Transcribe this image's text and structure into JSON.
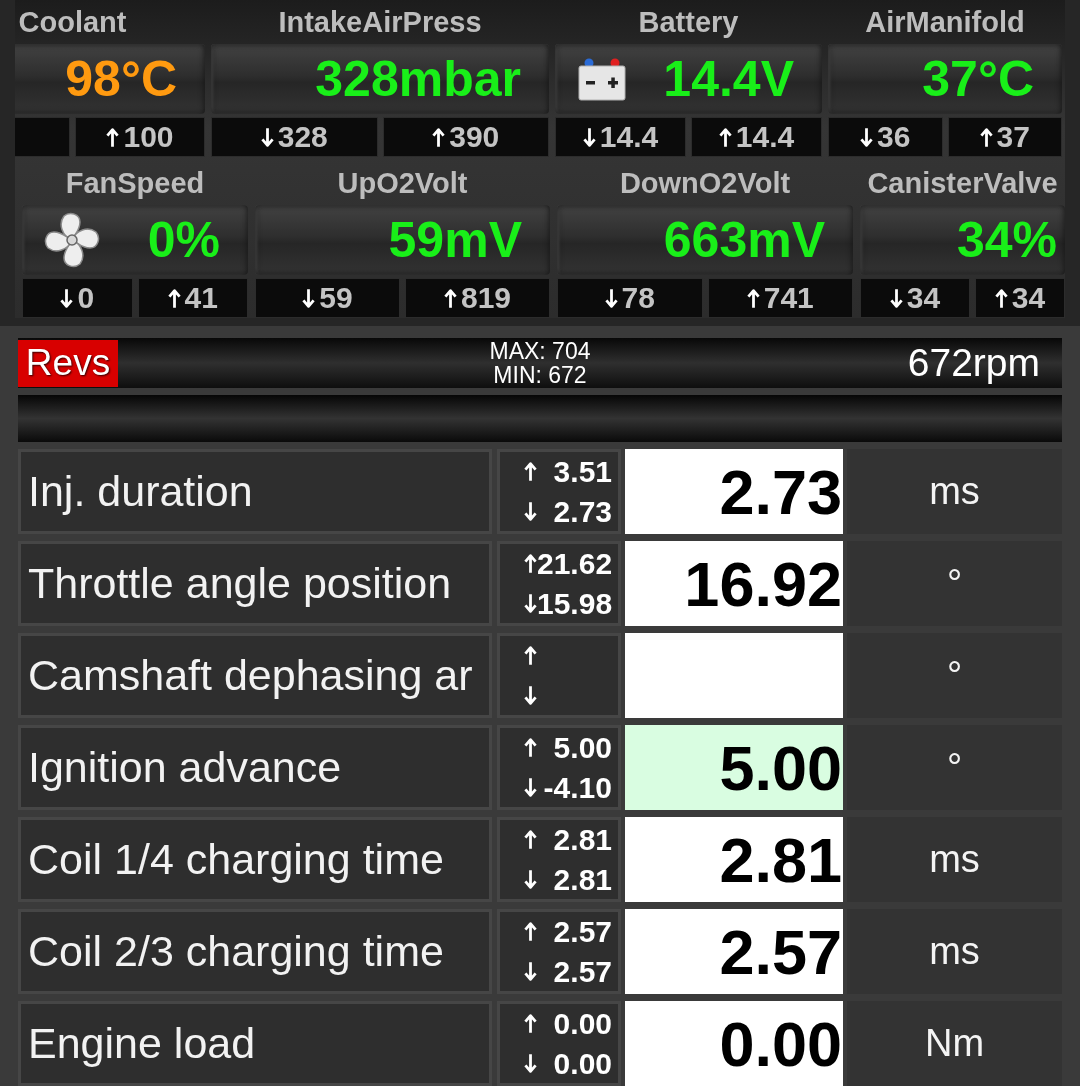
{
  "gauge_rows": [
    {
      "gauges": [
        {
          "label": "Coolant",
          "kind": "plain",
          "value": "98°C",
          "alert": true,
          "max": "100"
        },
        {
          "label": "IntakeAirPress",
          "kind": "plain",
          "value": "328mbar",
          "alert": false,
          "min": "328",
          "max": "390"
        },
        {
          "label": "Battery",
          "kind": "battery",
          "value": "14.4V",
          "alert": false,
          "min": "14.4",
          "max": "14.4"
        },
        {
          "label": "AirManifold",
          "kind": "plain",
          "value": "37°C",
          "alert": false,
          "min": "36",
          "max": "37"
        }
      ]
    },
    {
      "gauges": [
        {
          "label": "FanSpeed",
          "kind": "fan",
          "value": "0%",
          "alert": false,
          "min": "0",
          "max": "41"
        },
        {
          "label": "UpO2Volt",
          "kind": "plain",
          "value": "59mV",
          "alert": false,
          "min": "59",
          "max": "819"
        },
        {
          "label": "DownO2Volt",
          "kind": "plain",
          "value": "663mV",
          "alert": false,
          "min": "78",
          "max": "741"
        },
        {
          "label": "CanisterValve",
          "kind": "plain",
          "value": "34%",
          "alert": false,
          "min": "34",
          "max": "34"
        }
      ]
    }
  ],
  "revs": {
    "label": "Revs",
    "max": "MAX: 704",
    "min": "MIN: 672",
    "value": "672rpm"
  },
  "table": {
    "rows": [
      {
        "name": "Inj. duration",
        "max": "3.51",
        "min": "2.73",
        "value": "2.73",
        "unit": "ms",
        "highlighted": false
      },
      {
        "name": "Throttle angle position",
        "max": "21.62",
        "min": "15.98",
        "value": "16.92",
        "unit": "°",
        "highlighted": false
      },
      {
        "name": "Camshaft dephasing ar",
        "unit": "°",
        "highlighted": false
      },
      {
        "name": "Ignition advance",
        "max": "5.00",
        "min": "-4.10",
        "value": "5.00",
        "unit": "°",
        "highlighted": true
      },
      {
        "name": "Coil 1/4 charging time",
        "max": "2.81",
        "min": "2.81",
        "value": "2.81",
        "unit": "ms",
        "highlighted": false
      },
      {
        "name": "Coil 2/3 charging time",
        "max": "2.57",
        "min": "2.57",
        "value": "2.57",
        "unit": "ms",
        "highlighted": false
      },
      {
        "name": "Engine load",
        "max": "0.00",
        "min": "0.00",
        "value": "0.00",
        "unit": "Nm",
        "highlighted": false
      }
    ]
  }
}
